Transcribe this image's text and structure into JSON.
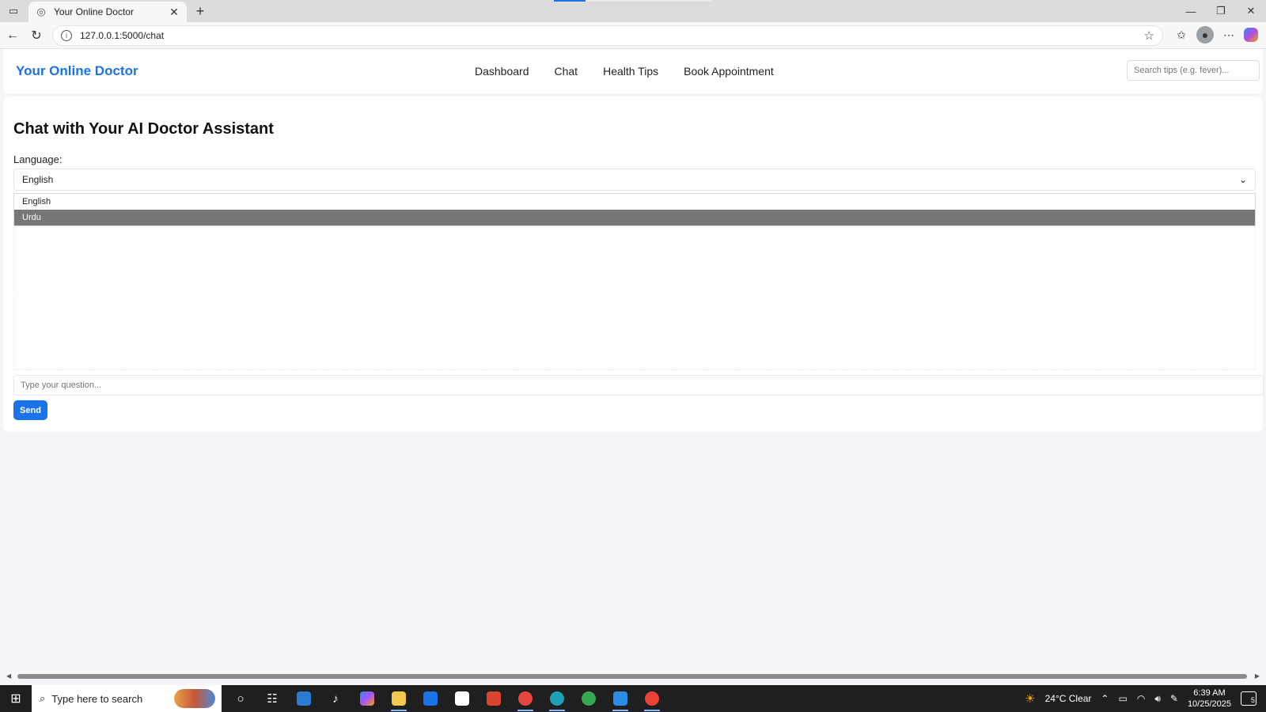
{
  "browser": {
    "tab_title": "Your Online Doctor",
    "url": "127.0.0.1:5000/chat"
  },
  "header": {
    "brand": "Your Online Doctor",
    "nav": [
      "Dashboard",
      "Chat",
      "Health Tips",
      "Book Appointment"
    ],
    "search_placeholder": "Search tips (e.g. fever)..."
  },
  "chat": {
    "title": "Chat with Your AI Doctor Assistant",
    "language_label": "Language:",
    "language_selected": "English",
    "language_options": [
      "English",
      "Urdu"
    ],
    "highlighted_option": "Urdu",
    "question_placeholder": "Type your question...",
    "send_label": "Send"
  },
  "taskbar": {
    "search_placeholder": "Type here to search",
    "weather": "24°C  Clear",
    "time": "6:39 AM",
    "date": "10/25/2025",
    "notification_count": "5"
  },
  "colors": {
    "accent": "#1a73e8",
    "highlight": "#777777"
  }
}
